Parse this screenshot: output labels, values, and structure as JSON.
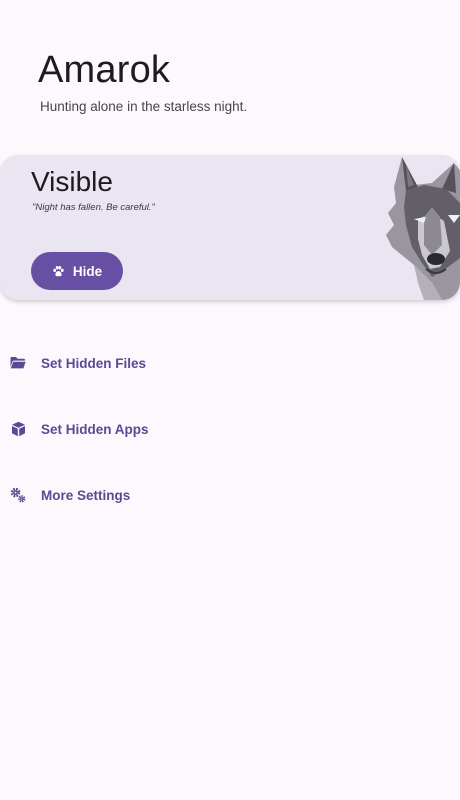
{
  "header": {
    "title": "Amarok",
    "subtitle": "Hunting alone in the starless night."
  },
  "status_card": {
    "title": "Visible",
    "quote": "\"Night has fallen. Be careful.\"",
    "button_label": "Hide",
    "button_icon": "paw-icon",
    "image": "wolf-illustration"
  },
  "menu": {
    "items": [
      {
        "label": "Set Hidden Files",
        "icon": "folder-icon"
      },
      {
        "label": "Set Hidden Apps",
        "icon": "cube-icon"
      },
      {
        "label": "More Settings",
        "icon": "gears-icon"
      }
    ]
  },
  "colors": {
    "background": "#fdf8fd",
    "card": "#eae5f0",
    "accent": "#6750a4",
    "menu_text": "#5a4a94"
  }
}
